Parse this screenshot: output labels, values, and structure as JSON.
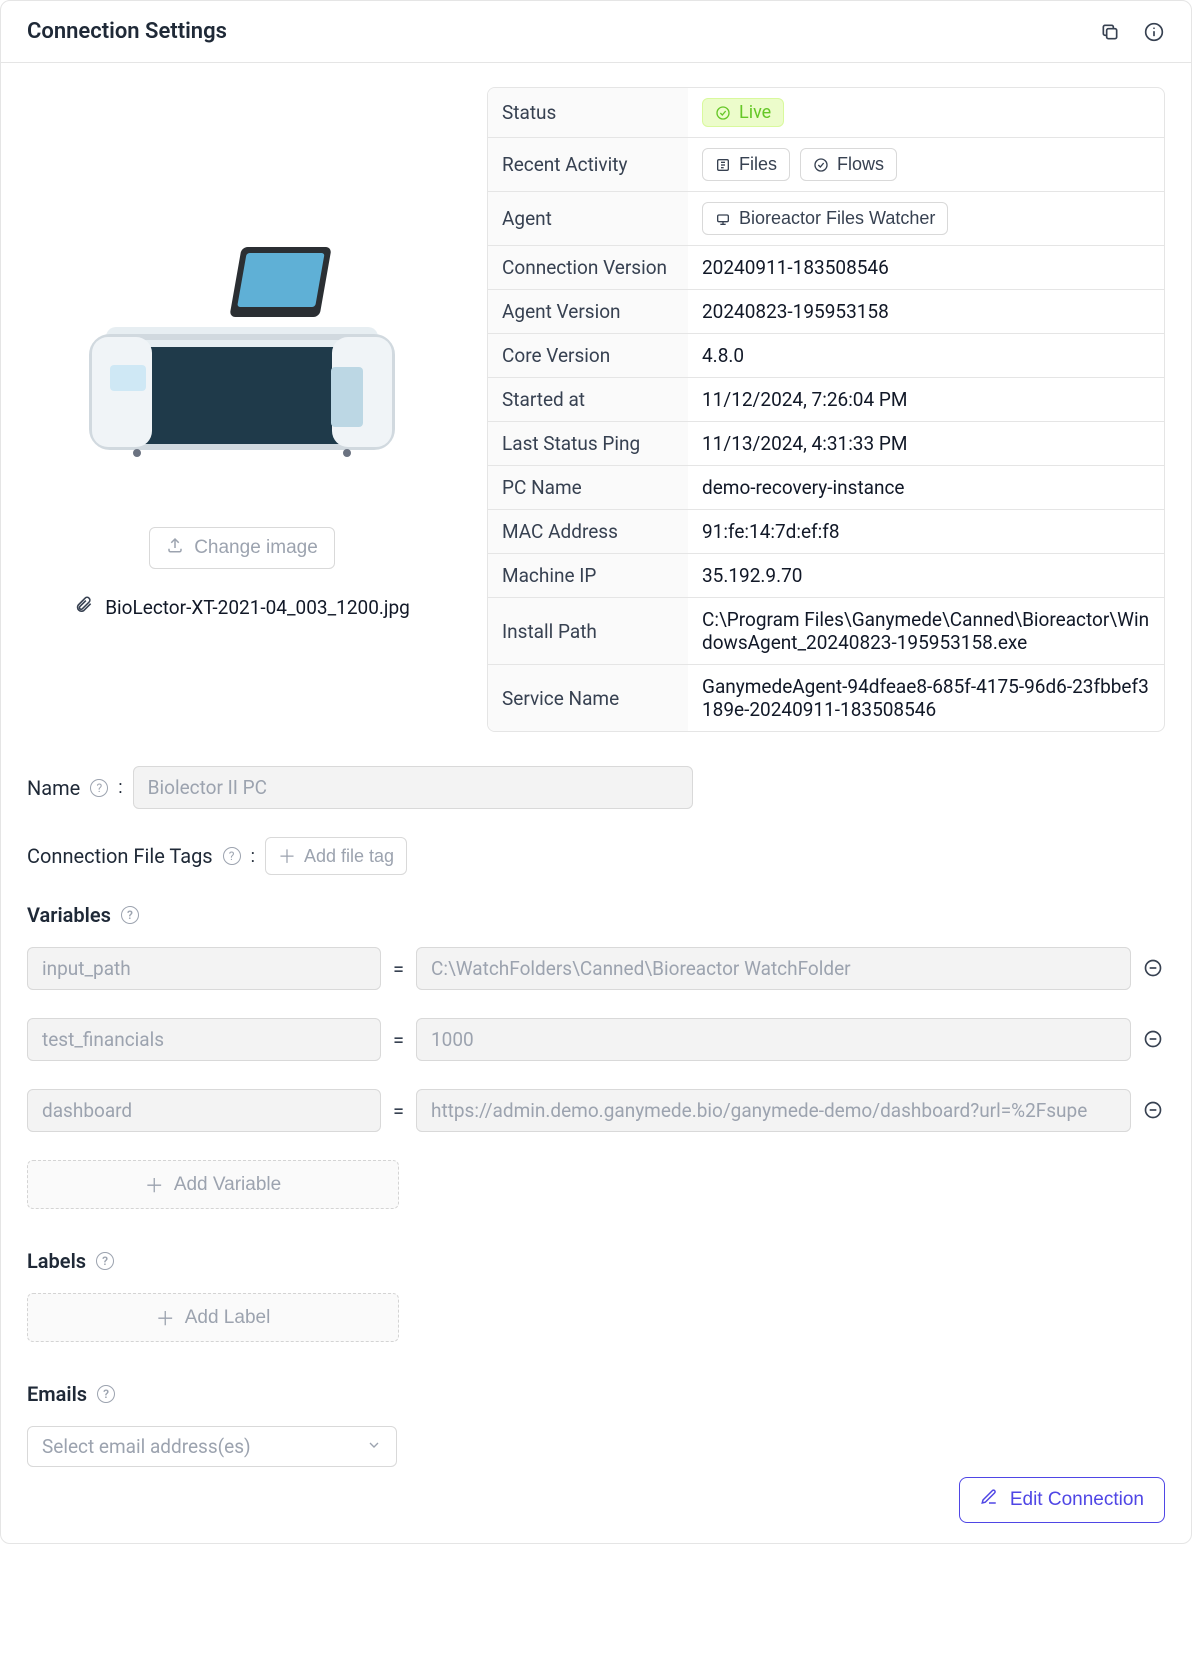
{
  "header": {
    "title": "Connection Settings"
  },
  "image": {
    "change_label": "Change image",
    "filename": "BioLector-XT-2021-04_003_1200.jpg"
  },
  "status_live": "Live",
  "activity": {
    "files": "Files",
    "flows": "Flows"
  },
  "details": [
    {
      "label": "Status",
      "value": "__live"
    },
    {
      "label": "Recent Activity",
      "value": "__activity"
    },
    {
      "label": "Agent",
      "value": "__agent"
    },
    {
      "label": "Connection Version",
      "value": "20240911-183508546"
    },
    {
      "label": "Agent Version",
      "value": "20240823-195953158"
    },
    {
      "label": "Core Version",
      "value": "4.8.0"
    },
    {
      "label": "Started at",
      "value": "11/12/2024, 7:26:04 PM"
    },
    {
      "label": "Last Status Ping",
      "value": "11/13/2024, 4:31:33 PM"
    },
    {
      "label": "PC Name",
      "value": "demo-recovery-instance"
    },
    {
      "label": "MAC Address",
      "value": "91:fe:14:7d:ef:f8"
    },
    {
      "label": "Machine IP",
      "value": "35.192.9.70"
    },
    {
      "label": "Install Path",
      "value": "C:\\Program Files\\Ganymede\\Canned\\Bioreactor\\WindowsAgent_20240823-195953158.exe"
    },
    {
      "label": "Service Name",
      "value": "GanymedeAgent-94dfeae8-685f-4175-96d6-23fbbef3189e-20240911-183508546"
    }
  ],
  "agent_name": "Bioreactor Files Watcher",
  "form": {
    "name_label": "Name",
    "name_value": "Biolector II PC",
    "file_tags_label": "Connection File Tags",
    "add_file_tag": "Add file tag",
    "variables_label": "Variables",
    "add_variable": "Add Variable",
    "labels_label": "Labels",
    "add_label": "Add Label",
    "emails_label": "Emails",
    "email_placeholder": "Select email address(es)"
  },
  "variables": [
    {
      "name": "input_path",
      "value": "C:\\WatchFolders\\Canned\\Bioreactor WatchFolder"
    },
    {
      "name": "test_financials",
      "value": "1000"
    },
    {
      "name": "dashboard",
      "value": "https://admin.demo.ganymede.bio/ganymede-demo/dashboard?url=%2Fsupe"
    }
  ],
  "edit_label": "Edit Connection"
}
